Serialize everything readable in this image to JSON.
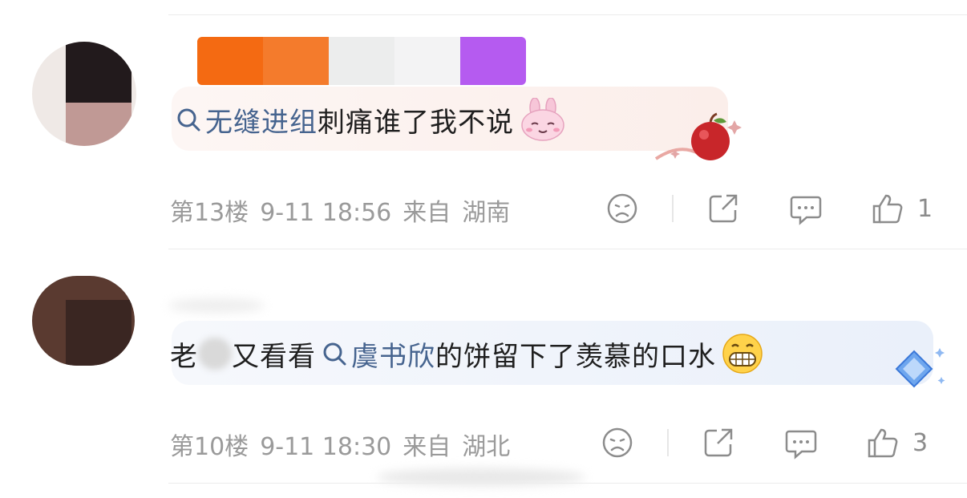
{
  "colors": {
    "topic": "#46648f",
    "meta": "#9a9a9a",
    "icon": "#8c8c8c",
    "divider": "#ececec",
    "bubble1": "#fbf1ef",
    "bubble2": "#eef3fb"
  },
  "comments": [
    {
      "topic_link": "无缝进组",
      "text": "刺痛谁了我不说",
      "emoji": "bunny-smile-emoji",
      "floor": "第13楼",
      "time": "9-11 18:56",
      "from_label": "来自",
      "location": "湖南",
      "like_count": "1"
    },
    {
      "text_prefix": "老",
      "text_prefix2": "又看看",
      "topic_link": "虞书欣",
      "text": "的饼留下了羡慕的口水",
      "emoji": "grin-emoji",
      "floor": "第10楼",
      "time": "9-11 18:30",
      "from_label": "来自",
      "location": "湖北",
      "like_count": "3"
    }
  ],
  "icons": [
    "dislike-icon",
    "share-icon",
    "comment-icon",
    "like-icon",
    "search-icon"
  ]
}
